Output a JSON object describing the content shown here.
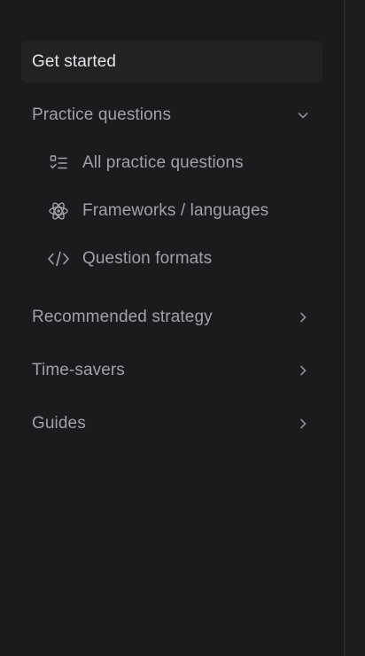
{
  "sidebar": {
    "get_started": {
      "label": "Get started"
    },
    "practice_questions": {
      "label": "Practice questions",
      "expanded": true,
      "children": [
        {
          "label": "All practice questions",
          "icon": "checklist-icon"
        },
        {
          "label": "Frameworks / languages",
          "icon": "atom-icon"
        },
        {
          "label": "Question formats",
          "icon": "code-icon"
        }
      ]
    },
    "recommended_strategy": {
      "label": "Recommended strategy",
      "expanded": false
    },
    "time_savers": {
      "label": "Time-savers",
      "expanded": false
    },
    "guides": {
      "label": "Guides",
      "expanded": false
    }
  },
  "colors": {
    "background": "#1b1b1d",
    "active_item_bg": "#222224",
    "text_primary": "#e4e4e7",
    "text_secondary": "#a1a1a6",
    "divider": "#2a2a2d"
  }
}
